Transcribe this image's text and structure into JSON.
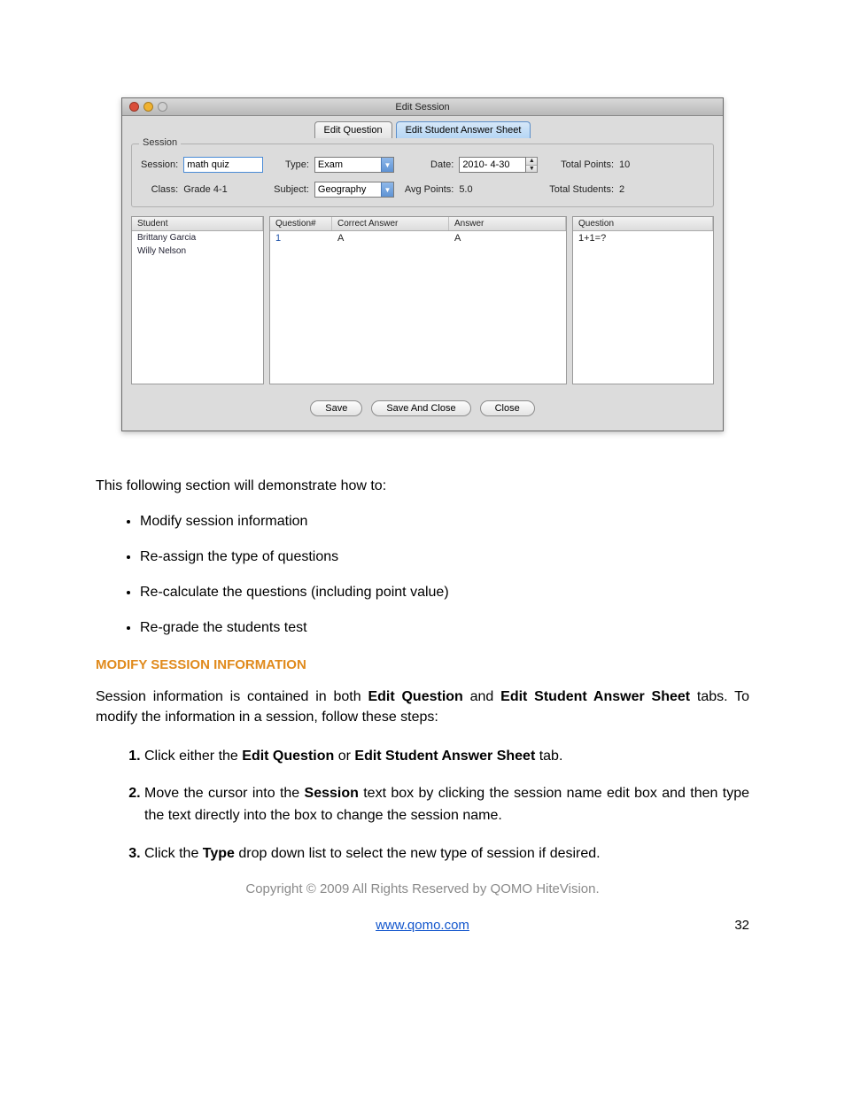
{
  "window": {
    "title": "Edit Session",
    "tabs": {
      "edit_question": "Edit Question",
      "edit_sheet": "Edit Student Answer Sheet"
    },
    "group_legend": "Session",
    "labels": {
      "session": "Session:",
      "type": "Type:",
      "date": "Date:",
      "totalpoints": "Total Points:",
      "class": "Class:",
      "subject": "Subject:",
      "avgpoints": "Avg Points:",
      "totalstudents": "Total Students:"
    },
    "values": {
      "session": "math quiz",
      "type": "Exam",
      "date": "2010- 4-30",
      "totalpoints": "10",
      "class": "Grade 4-1",
      "subject": "Geography",
      "avgpoints": "5.0",
      "totalstudents": "2"
    },
    "columns": {
      "student": "Student",
      "qnum": "Question#",
      "correct": "Correct Answer",
      "answer": "Answer",
      "question": "Question"
    },
    "students": {
      "s0": "Brittany Garcia",
      "s1": "Willy Nelson"
    },
    "qrow": {
      "num": "1",
      "correct": "A",
      "answer": "A"
    },
    "preview": "1+1=?",
    "buttons": {
      "save": "Save",
      "saveclose": "Save And Close",
      "close": "Close"
    }
  },
  "doc": {
    "intro": "This following section will demonstrate how to:",
    "bullets": {
      "b0": "Modify session information",
      "b1": "Re-assign the type of questions",
      "b2": "Re-calculate the questions (including point value)",
      "b3": "Re-grade the students test"
    },
    "heading": "MODIFY SESSION INFORMATION",
    "para_parts": {
      "p0": "Session information is contained in both ",
      "p1": "Edit Question",
      "p2": " and ",
      "p3": "Edit Student Answer Sheet",
      "p4": " tabs. To modify the information in a session, follow these steps:"
    },
    "steps": {
      "s1a": "Click either the ",
      "s1b": "Edit Question",
      "s1c": " or ",
      "s1d": "Edit Student Answer Sheet",
      "s1e": " tab.",
      "s2a": "Move the cursor into the ",
      "s2b": "Session",
      "s2c": " text box by clicking the session name edit box and then type the text directly into the box to change the session name.",
      "s3a": "Click the ",
      "s3b": "Type",
      "s3c": " drop down list to select the new type of session if desired."
    },
    "footer": "Copyright © 2009 All Rights Reserved by QOMO HiteVision.",
    "link": "www.qomo.com",
    "pagenum": "32"
  }
}
